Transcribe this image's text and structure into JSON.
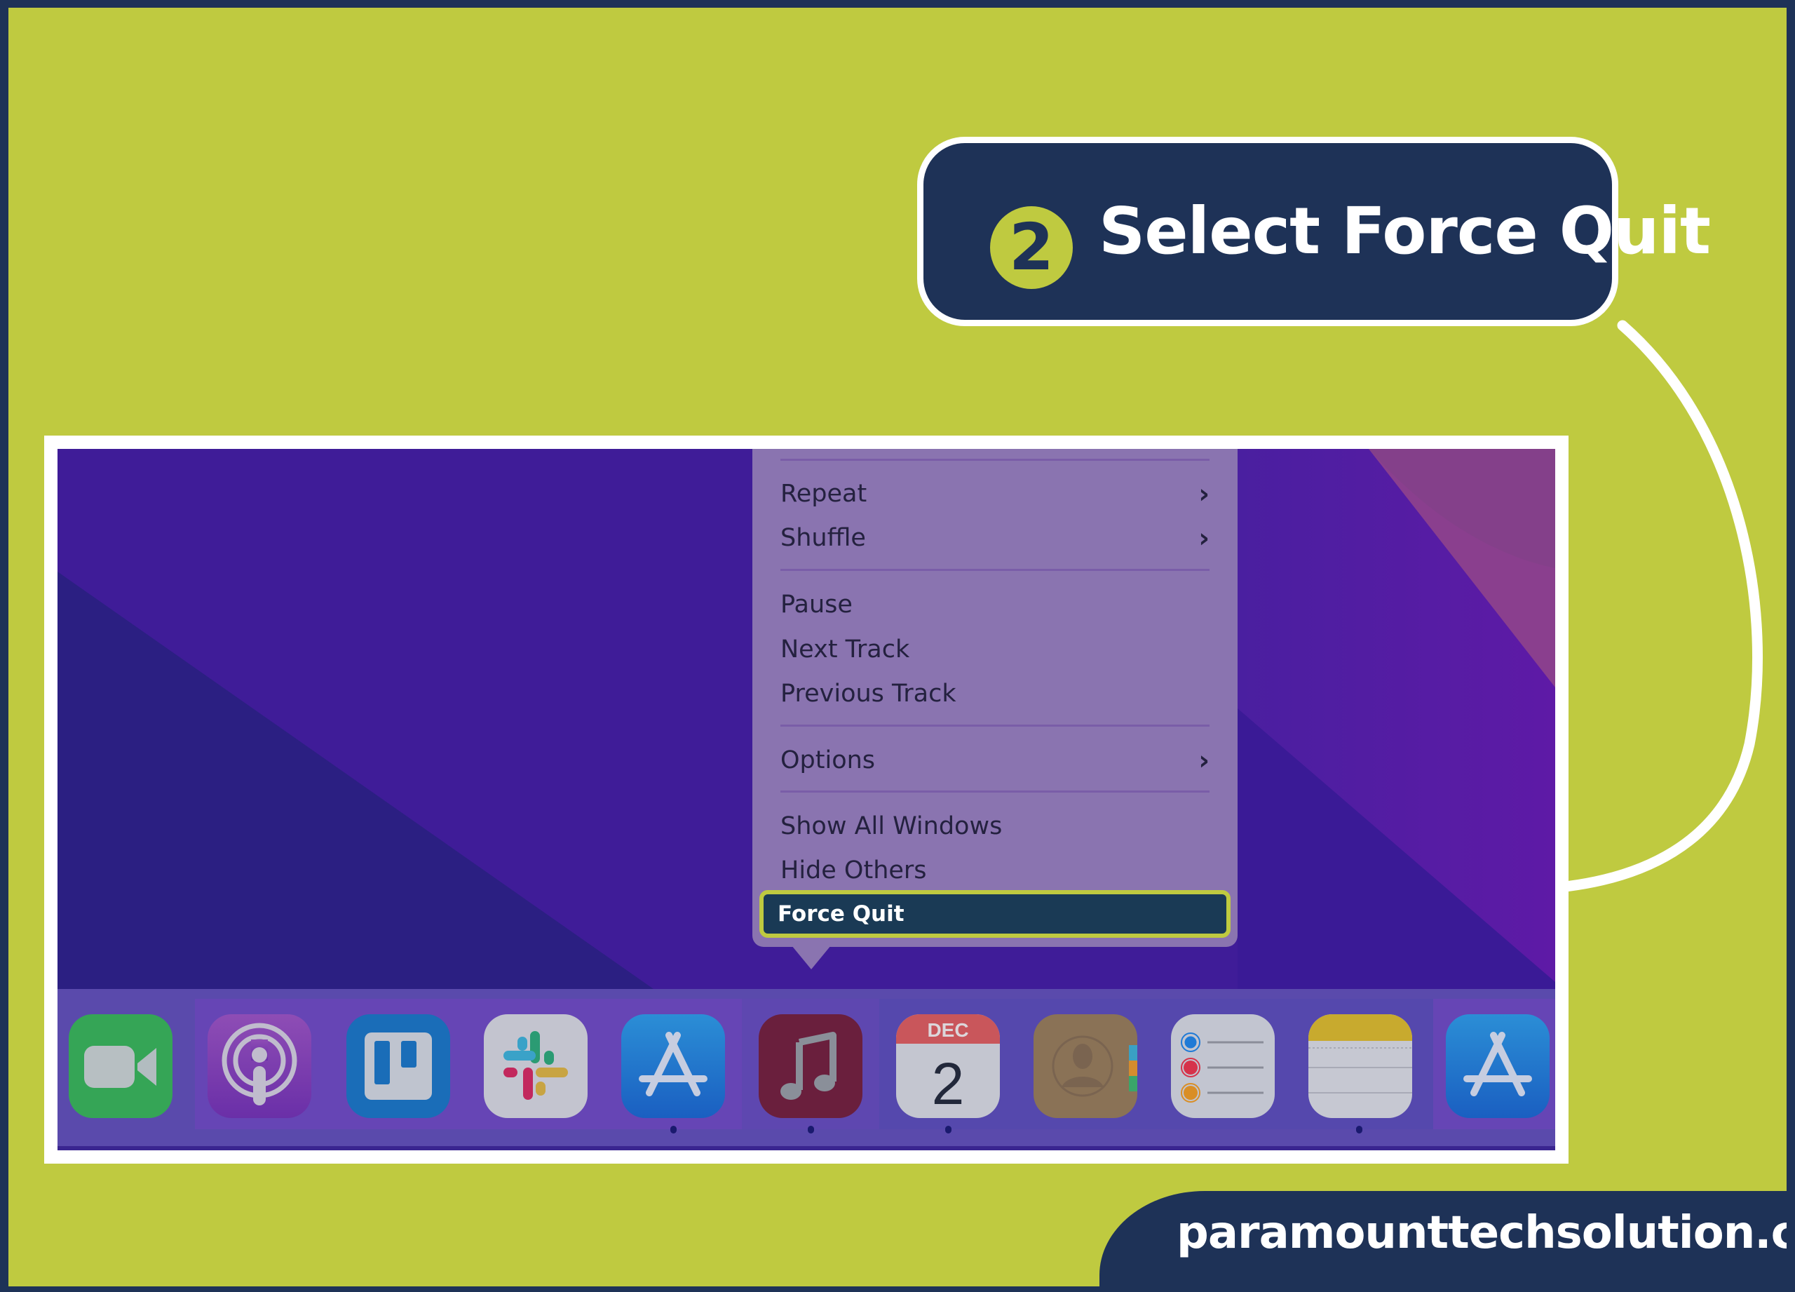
{
  "callout": {
    "step_number": "2",
    "label": "Select Force Quit"
  },
  "menu": {
    "items": [
      {
        "label": "Repeat",
        "submenu": true
      },
      {
        "label": "Shuffle",
        "submenu": true
      },
      {
        "label": "Pause",
        "submenu": false
      },
      {
        "label": "Next Track",
        "submenu": false
      },
      {
        "label": "Previous Track",
        "submenu": false
      },
      {
        "label": "Options",
        "submenu": true
      },
      {
        "label": "Show All Windows",
        "submenu": false
      },
      {
        "label": "Hide Others",
        "submenu": false
      }
    ],
    "highlighted": "Force Quit",
    "chevron": "›"
  },
  "dock": {
    "apps": [
      {
        "name": "FaceTime",
        "running": false
      },
      {
        "name": "Podcasts",
        "running": false
      },
      {
        "name": "Trello",
        "running": false
      },
      {
        "name": "Slack",
        "running": false
      },
      {
        "name": "App Store",
        "running": true
      },
      {
        "name": "Music",
        "running": true
      },
      {
        "name": "Calendar",
        "running": true,
        "month": "DEC",
        "day": "2"
      },
      {
        "name": "Contacts",
        "running": false
      },
      {
        "name": "Reminders",
        "running": false
      },
      {
        "name": "Notes",
        "running": true
      },
      {
        "name": "App Store",
        "running": false
      }
    ]
  },
  "footer": {
    "website": "paramounttechsolution.com"
  },
  "colors": {
    "brand_lime": "#bfca40",
    "brand_navy": "#1e3257",
    "highlight_fill": "#1a3a55"
  }
}
